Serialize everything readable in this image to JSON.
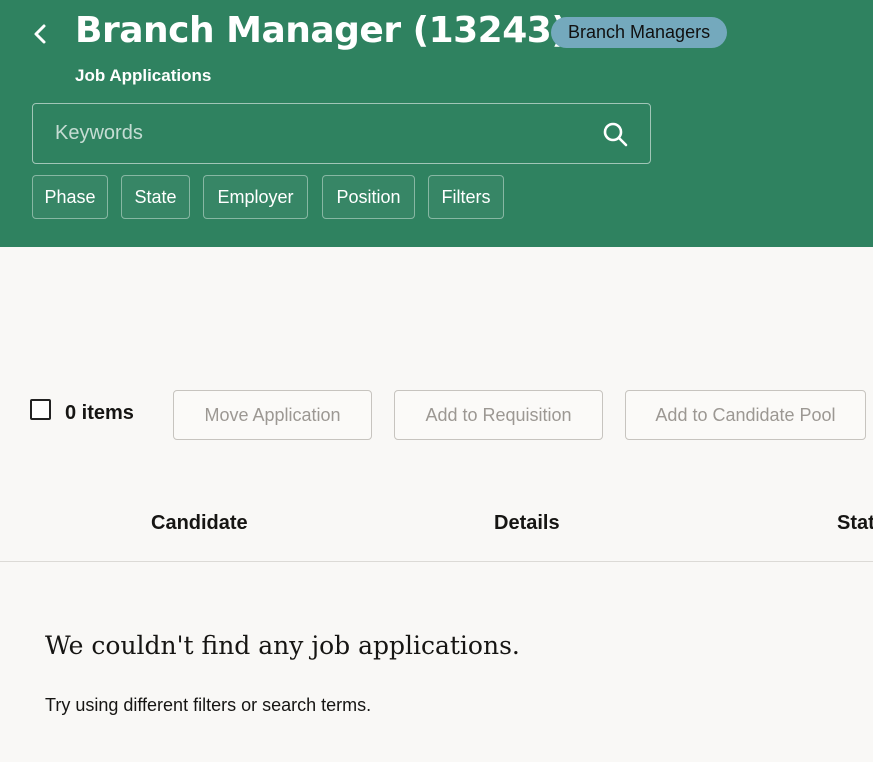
{
  "header": {
    "title": "Branch Manager (13243)",
    "badge": "Branch Managers",
    "subtitle": "Job Applications",
    "background_color": "#2f8260"
  },
  "search": {
    "placeholder": "Keywords",
    "value": ""
  },
  "filters": [
    "Phase",
    "State",
    "Employer",
    "Position",
    "Filters"
  ],
  "toolbar": {
    "items_count": "0 items",
    "actions": [
      "Move Application",
      "Add to Requisition",
      "Add to Candidate Pool"
    ]
  },
  "table": {
    "columns": [
      "Candidate",
      "Details",
      "Status"
    ]
  },
  "empty_state": {
    "title": "We couldn't find any job applications.",
    "message": "Try using different filters or search terms."
  },
  "icons": {
    "back": "chevron-left-icon",
    "search": "search-icon",
    "checkbox": "checkbox-unchecked"
  }
}
